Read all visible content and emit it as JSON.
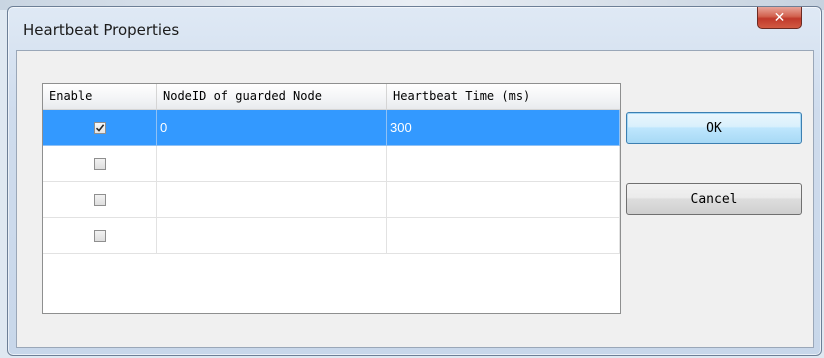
{
  "window": {
    "title": "Heartbeat Properties",
    "close_glyph": "✕"
  },
  "table": {
    "columns": [
      "Enable",
      "NodeID of guarded Node",
      "Heartbeat Time (ms)"
    ],
    "rows": [
      {
        "enabled": true,
        "node_id": "0",
        "heartbeat_ms": "300",
        "selected": true
      },
      {
        "enabled": false,
        "node_id": "",
        "heartbeat_ms": "",
        "selected": false
      },
      {
        "enabled": false,
        "node_id": "",
        "heartbeat_ms": "",
        "selected": false
      },
      {
        "enabled": false,
        "node_id": "",
        "heartbeat_ms": "",
        "selected": false
      }
    ]
  },
  "buttons": {
    "ok_label": "OK",
    "cancel_label": "Cancel"
  },
  "colors": {
    "selection": "#3399ff",
    "close_button": "#c0392b"
  }
}
